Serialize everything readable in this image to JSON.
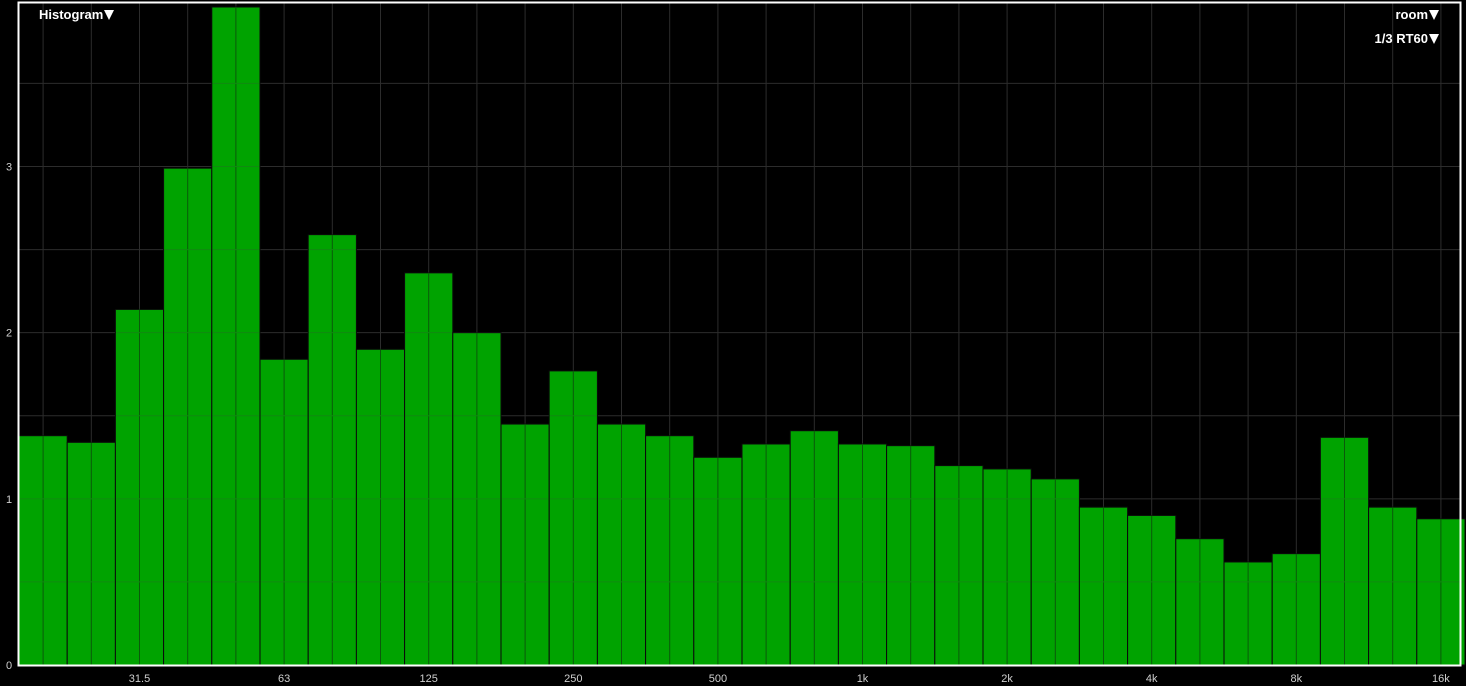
{
  "menus": {
    "view_label": "Histogram",
    "room_label": "room",
    "band_label": "1/3 RT60"
  },
  "colors": {
    "background": "#000000",
    "bar_fill": "#00a300",
    "bar_edge": "#0a0a0a",
    "grid": "#2c2c2c",
    "frame": "#ffffff",
    "text": "#ffffff"
  },
  "icons": {
    "dropdown": "triangle-down-icon"
  },
  "chart_data": {
    "type": "bar",
    "title": "",
    "xlabel": "",
    "ylabel": "",
    "xscale": "log (1/3 octave bands)",
    "ylim": [
      0,
      3.96
    ],
    "grid": true,
    "categories": [
      "20",
      "25",
      "31.5",
      "40",
      "50",
      "63",
      "80",
      "100",
      "125",
      "160",
      "200",
      "250",
      "315",
      "400",
      "500",
      "630",
      "800",
      "1k",
      "1.25k",
      "1.6k",
      "2k",
      "2.5k",
      "3.15k",
      "4k",
      "5k",
      "6.3k",
      "8k",
      "10k",
      "12.5k",
      "16k"
    ],
    "values": [
      1.38,
      1.34,
      2.14,
      2.99,
      3.96,
      1.84,
      2.59,
      1.9,
      2.36,
      2.0,
      1.45,
      1.77,
      1.45,
      1.38,
      1.25,
      1.33,
      1.41,
      1.33,
      1.32,
      1.2,
      1.18,
      1.12,
      0.95,
      0.9,
      0.76,
      0.62,
      0.67,
      1.37,
      0.95,
      0.88
    ],
    "x_tick_labels": [
      "31.5",
      "63",
      "125",
      "250",
      "500",
      "1k",
      "2k",
      "4k",
      "8k",
      "16k"
    ],
    "y_tick_labels": [
      "0",
      "1",
      "2",
      "3"
    ],
    "y_ticks": [
      0,
      1,
      2,
      3
    ]
  }
}
